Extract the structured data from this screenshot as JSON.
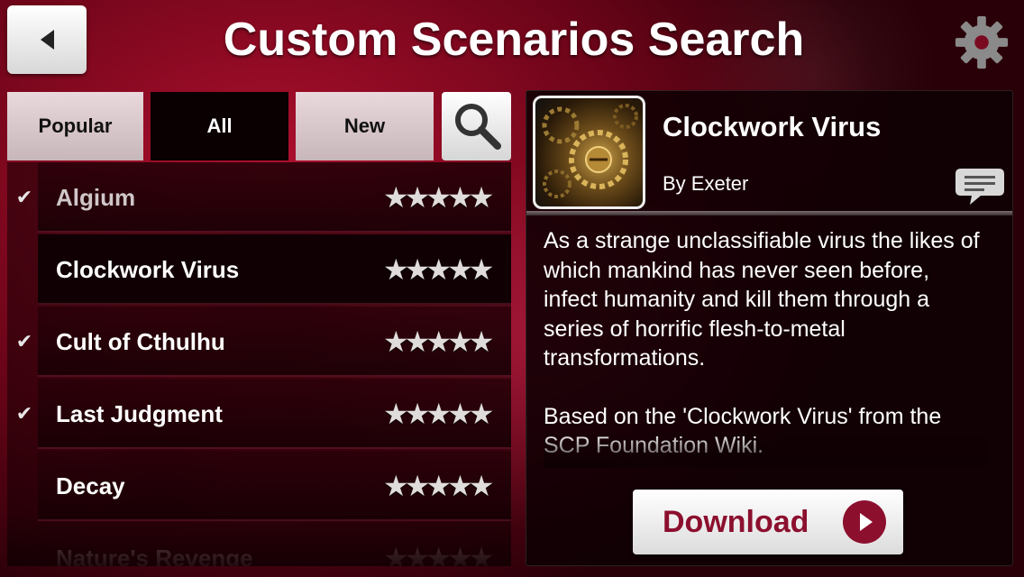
{
  "header": {
    "title": "Custom Scenarios Search"
  },
  "tabs": [
    {
      "label": "Popular",
      "active": false
    },
    {
      "label": "All",
      "active": true
    },
    {
      "label": "New",
      "active": false
    }
  ],
  "list": {
    "items": [
      {
        "name": "Algium",
        "checked": true,
        "rating": 4.5
      },
      {
        "name": "Clockwork Virus",
        "checked": false,
        "rating": 4.5,
        "selected": true
      },
      {
        "name": "Cult of Cthulhu",
        "checked": true,
        "rating": 4.5
      },
      {
        "name": "Last Judgment",
        "checked": true,
        "rating": 4.5
      },
      {
        "name": "Decay",
        "checked": false,
        "rating": 4.5
      },
      {
        "name": "Nature's Revenge",
        "checked": false,
        "rating": 4.5
      }
    ],
    "check_glyph": "✔",
    "stars_glyph": "★★★★★"
  },
  "detail": {
    "title": "Clockwork Virus",
    "author": "By Exeter",
    "description": [
      "As a strange unclassifiable virus the likes of which mankind has never seen before, infect humanity and kill them through a series of horrific flesh-to-metal transformations.",
      "Based on the 'Clockwork Virus' from the SCP Foundation Wiki."
    ],
    "download_label": "Download"
  },
  "colors": {
    "accent": "#8c0f2e",
    "background": "#a0102a"
  }
}
